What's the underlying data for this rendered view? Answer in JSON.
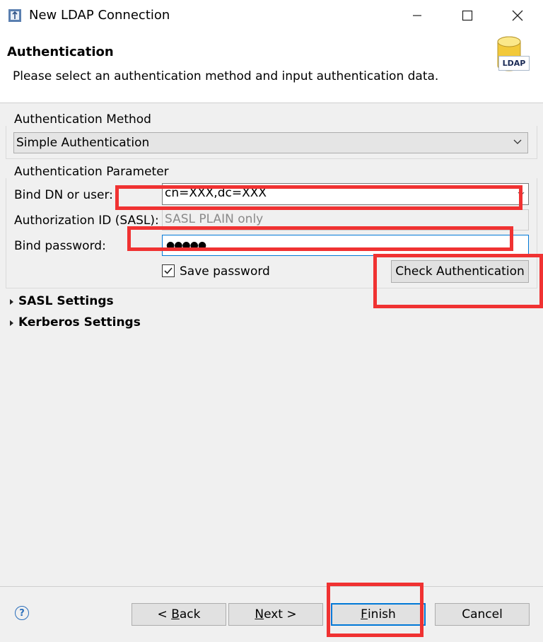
{
  "window": {
    "title": "New LDAP Connection"
  },
  "banner": {
    "title": "Authentication",
    "description": "Please select an authentication method and input authentication data.",
    "icon_label": "LDAP"
  },
  "auth_method": {
    "group_label": "Authentication Method",
    "selected": "Simple Authentication"
  },
  "auth_params": {
    "group_label": "Authentication Parameter",
    "bind_dn_label": "Bind DN or user:",
    "bind_dn_value": "cn=XXX,dc=XXX",
    "authz_id_label": "Authorization ID (SASL):",
    "authz_id_placeholder": "SASL PLAIN only",
    "password_label": "Bind password:",
    "password_mask": "●●●●●",
    "save_password_label": "Save password",
    "save_password_checked": true,
    "check_auth_label": "Check Authentication"
  },
  "sections": {
    "sasl_label": "SASL Settings",
    "kerberos_label": "Kerberos Settings"
  },
  "footer": {
    "back_prefix": "< ",
    "back_key": "B",
    "back_rest": "ack",
    "next_key": "N",
    "next_rest": "ext >",
    "finish_key": "F",
    "finish_rest": "inish",
    "cancel_label": "Cancel",
    "help_glyph": "?"
  },
  "colors": {
    "highlight": "#f03232",
    "focus": "#0078d7",
    "help": "#2a6ebb"
  },
  "icons": [
    "app-icon",
    "minimize-icon",
    "maximize-icon",
    "close-icon",
    "ldap-database-icon",
    "dropdown-arrow-icon",
    "checkmark-icon",
    "expand-arrow-icon",
    "help-icon"
  ]
}
